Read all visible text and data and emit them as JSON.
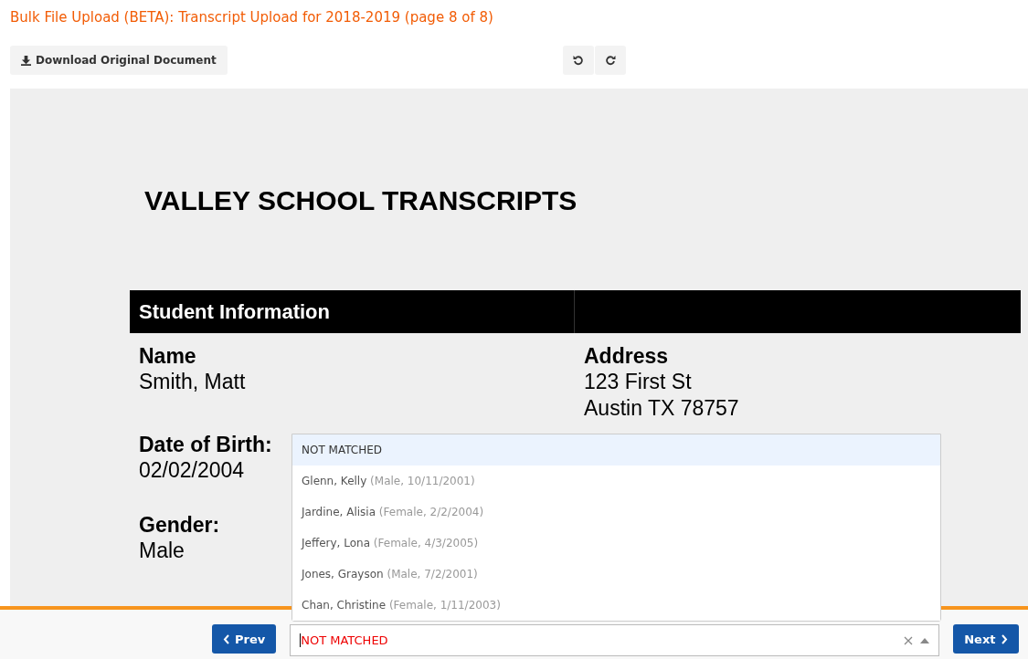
{
  "title": "Bulk File Upload (BETA): Transcript Upload for 2018-2019 (page 8 of 8)",
  "toolbar": {
    "download": "Download Original Document"
  },
  "document": {
    "heading": "VALLEY SCHOOL TRANSCRIPTS",
    "section_title": "Student Information",
    "rows": [
      [
        {
          "label": "Name",
          "lines": [
            "Smith, Matt"
          ]
        },
        {
          "label": "Address",
          "lines": [
            "123 First St",
            "Austin TX 78757"
          ]
        }
      ],
      [
        {
          "label": "Date of Birth:",
          "lines": [
            "02/02/2004"
          ]
        }
      ],
      [
        {
          "label": "Gender:",
          "lines": [
            "Male"
          ]
        }
      ]
    ]
  },
  "footer": {
    "prev": "Prev",
    "next": "Next",
    "select": {
      "value": "NOT MATCHED",
      "open": true,
      "options": [
        {
          "name": "NOT MATCHED",
          "selected": true
        },
        {
          "name": "Glenn, Kelly",
          "detail": "(Male, 10/11/2001)",
          "selected": false
        },
        {
          "name": "Jardine, Alisia",
          "detail": "(Female, 2/2/2004)",
          "selected": false
        },
        {
          "name": "Jeffery, Lona",
          "detail": "(Female, 4/3/2005)",
          "selected": false
        },
        {
          "name": "Jones, Grayson",
          "detail": "(Male, 7/2/2001)",
          "selected": false
        },
        {
          "name": "Chan, Christine",
          "detail": "(Female, 1/11/2003)",
          "selected": false
        }
      ]
    }
  }
}
